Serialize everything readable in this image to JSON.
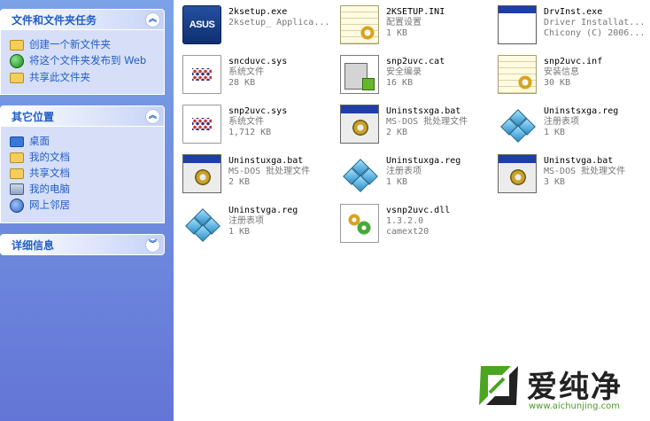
{
  "taskpane": {
    "file_tasks": {
      "title": "文件和文件夹任务",
      "collapse_glyph": "︽",
      "items": [
        {
          "label": "创建一个新文件夹",
          "icon": "new-folder-icon"
        },
        {
          "label": "将这个文件夹发布到 Web",
          "icon": "publish-web-icon"
        },
        {
          "label": "共享此文件夹",
          "icon": "share-folder-icon"
        }
      ]
    },
    "other_places": {
      "title": "其它位置",
      "collapse_glyph": "︽",
      "items": [
        {
          "label": "桌面",
          "icon": "desktop-icon"
        },
        {
          "label": "我的文档",
          "icon": "my-documents-icon"
        },
        {
          "label": "共享文档",
          "icon": "shared-documents-icon"
        },
        {
          "label": "我的电脑",
          "icon": "my-computer-icon"
        },
        {
          "label": "网上邻居",
          "icon": "network-places-icon"
        }
      ]
    },
    "details": {
      "title": "详细信息",
      "collapse_glyph": "︾"
    }
  },
  "files": [
    {
      "name": "2ksetup.exe",
      "line2": "2ksetup_ Applica...",
      "line3": "",
      "icon": "asus-exe-icon"
    },
    {
      "name": "2KSETUP.INI",
      "line2": "配置设置",
      "line3": "1 KB",
      "icon": "ini-file-icon"
    },
    {
      "name": "DrvInst.exe",
      "line2": "Driver Installat...",
      "line3": "Chicony (C) 2006...",
      "icon": "exe-window-icon"
    },
    {
      "name": "sncduvc.sys",
      "line2": "系统文件",
      "line3": "28 KB",
      "icon": "sys-file-icon"
    },
    {
      "name": "snp2uvc.cat",
      "line2": "安全编录",
      "line3": "16 KB",
      "icon": "cat-file-icon"
    },
    {
      "name": "snp2uvc.inf",
      "line2": "安装信息",
      "line3": "30 KB",
      "icon": "inf-file-icon"
    },
    {
      "name": "snp2uvc.sys",
      "line2": "系统文件",
      "line3": "1,712 KB",
      "icon": "sys-file-icon"
    },
    {
      "name": "Uninstsxga.bat",
      "line2": "MS-DOS 批处理文件",
      "line3": "2 KB",
      "icon": "bat-file-icon"
    },
    {
      "name": "Uninstsxga.reg",
      "line2": "注册表项",
      "line3": "1 KB",
      "icon": "reg-file-icon"
    },
    {
      "name": "Uninstuxga.bat",
      "line2": "MS-DOS 批处理文件",
      "line3": "2 KB",
      "icon": "bat-file-icon"
    },
    {
      "name": "Uninstuxga.reg",
      "line2": "注册表项",
      "line3": "1 KB",
      "icon": "reg-file-icon"
    },
    {
      "name": "Uninstvga.bat",
      "line2": "MS-DOS 批处理文件",
      "line3": "3 KB",
      "icon": "bat-file-icon"
    },
    {
      "name": "Uninstvga.reg",
      "line2": "注册表项",
      "line3": "1 KB",
      "icon": "reg-file-icon"
    },
    {
      "name": "vsnp2uvc.dll",
      "line2": "1.3.2.0",
      "line3": "camext20",
      "icon": "dll-file-icon"
    }
  ],
  "watermark": {
    "title": "爱纯净",
    "url": "www.aichunjing.com",
    "icon": "aichunjing-logo-icon"
  },
  "colors": {
    "pane_top": "#7ba2e7",
    "pane_bottom": "#6375d6",
    "link_blue": "#215dc6",
    "meta_gray": "#777777"
  }
}
